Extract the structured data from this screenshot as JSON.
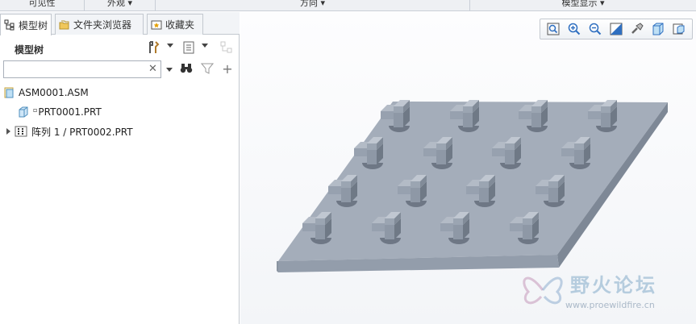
{
  "ribbon": {
    "groups": [
      "可见性",
      "外观",
      "方向",
      "模型显示"
    ]
  },
  "tabs": [
    {
      "label": "模型树",
      "icon": "model-tree-icon"
    },
    {
      "label": "文件夹浏览器",
      "icon": "folder-browser-icon"
    },
    {
      "label": "收藏夹",
      "icon": "favorites-icon"
    }
  ],
  "model_tree": {
    "title": "模型树",
    "search": {
      "value": "",
      "placeholder": ""
    },
    "nodes": [
      {
        "label": "ASM0001.ASM",
        "icon": "assembly-icon"
      },
      {
        "label": "PRT0001.PRT",
        "icon": "part-icon"
      },
      {
        "label": "阵列 1 / PRT0002.PRT",
        "icon": "pattern-icon"
      }
    ]
  },
  "view_toolbar": {
    "buttons": [
      "refit-icon",
      "zoom-in-icon",
      "zoom-out-icon",
      "repaint-icon",
      "spin-center-icon",
      "display-style-icon",
      "saved-orientations-icon"
    ]
  },
  "watermark": {
    "title": "野火论坛",
    "url": "www.proewildfire.cn"
  },
  "colors": {
    "model_top": "#a4adba",
    "model_side": "#7e8896",
    "model_front": "#939dab",
    "accent": "#2f6fc0"
  }
}
